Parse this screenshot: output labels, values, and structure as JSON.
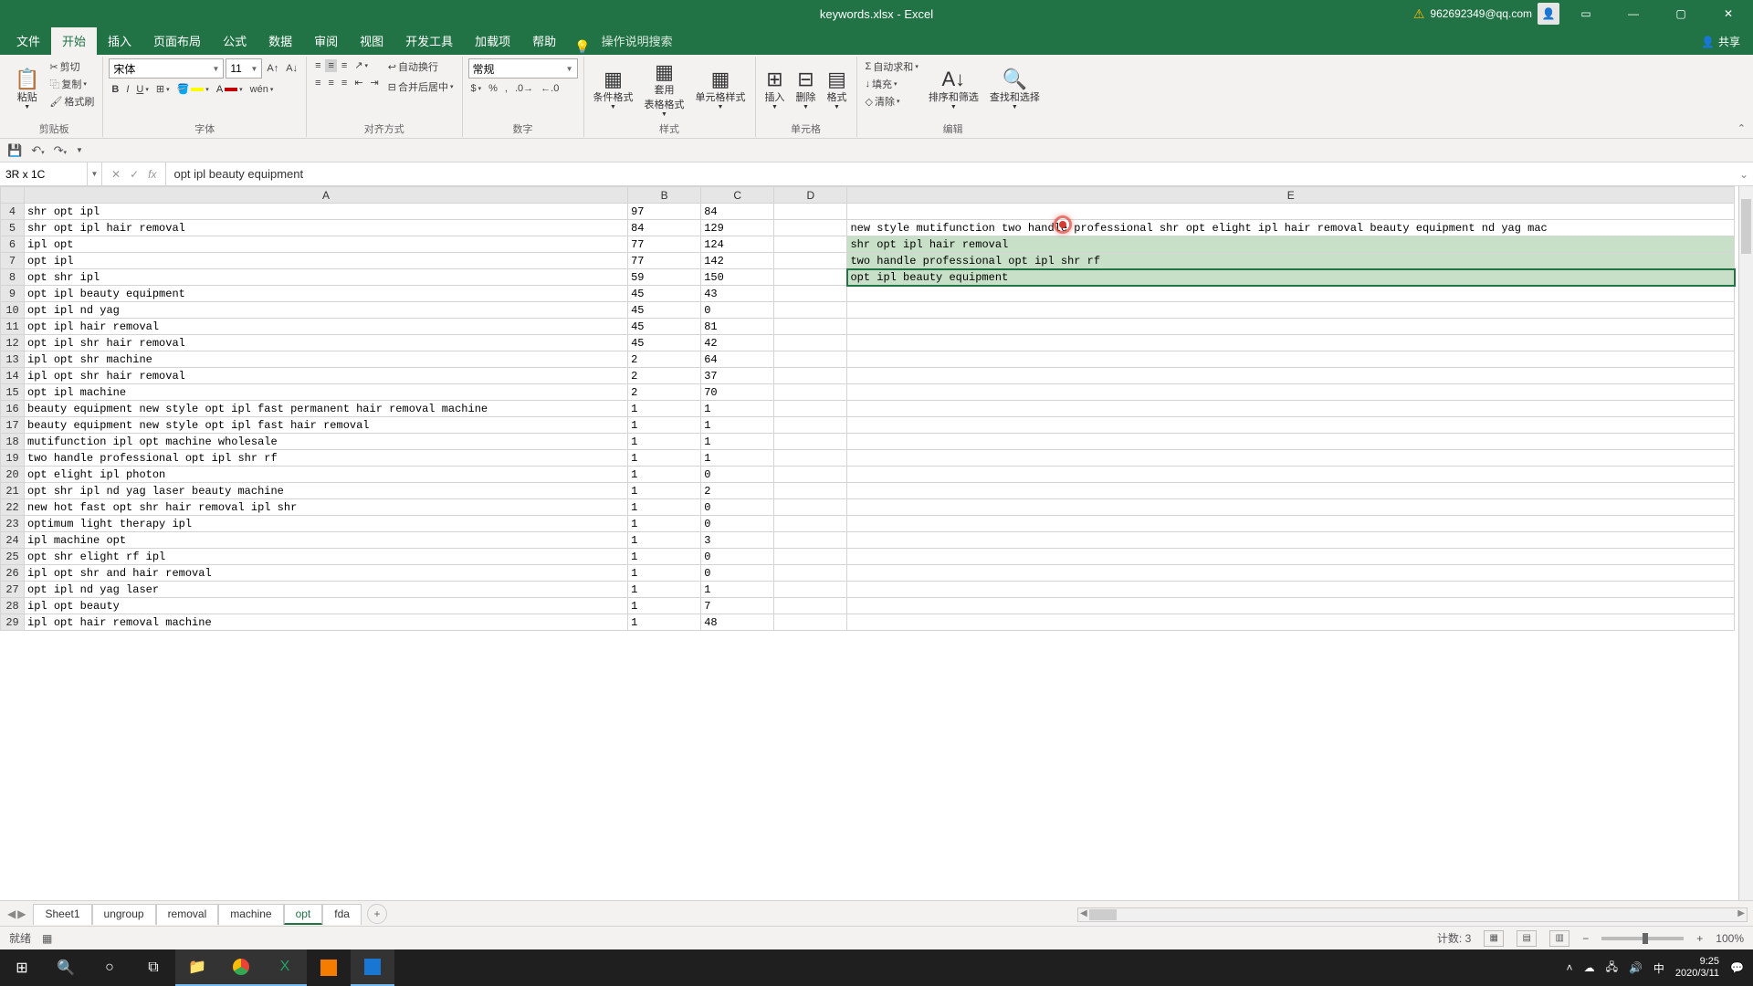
{
  "titlebar": {
    "title": "keywords.xlsx - Excel",
    "account": "962692349@qq.com"
  },
  "tabs": {
    "file": "文件",
    "home": "开始",
    "insert": "插入",
    "page": "页面布局",
    "formulas": "公式",
    "data": "数据",
    "review": "审阅",
    "view": "视图",
    "dev": "开发工具",
    "addins": "加载项",
    "help": "帮助",
    "tellme": "操作说明搜索",
    "share": "共享"
  },
  "ribbon": {
    "clipboard": {
      "paste": "粘贴",
      "cut": "剪切",
      "copy": "复制",
      "fmtpainter": "格式刷",
      "label": "剪贴板"
    },
    "font": {
      "name": "宋体",
      "size": "11",
      "label": "字体"
    },
    "align": {
      "wrap": "自动换行",
      "merge": "合并后居中",
      "label": "对齐方式"
    },
    "number": {
      "fmt": "常规",
      "label": "数字"
    },
    "styles": {
      "cond": "条件格式",
      "tbl": "套用\n表格格式",
      "cell": "单元格样式",
      "label": "样式"
    },
    "cells": {
      "ins": "插入",
      "del": "删除",
      "fmt": "格式",
      "label": "单元格"
    },
    "editing": {
      "sum": "自动求和",
      "fill": "填充",
      "clear": "清除",
      "sort": "排序和筛选",
      "find": "查找和选择",
      "label": "编辑"
    }
  },
  "namebox": "3R x 1C",
  "formula": "opt ipl beauty equipment",
  "columns": [
    "A",
    "B",
    "C",
    "D",
    "E"
  ],
  "rows": [
    {
      "n": 4,
      "a": "shr opt ipl",
      "b": "97",
      "c": "84",
      "e": ""
    },
    {
      "n": 5,
      "a": "shr opt ipl hair removal",
      "b": "84",
      "c": "129",
      "e": "new style mutifunction two handle professional shr opt elight ipl hair removal beauty equipment nd yag mac"
    },
    {
      "n": 6,
      "a": "ipl opt",
      "b": "77",
      "c": "124",
      "e": "shr opt ipl hair removal"
    },
    {
      "n": 7,
      "a": "opt ipl",
      "b": "77",
      "c": "142",
      "e": "two handle professional opt ipl shr rf"
    },
    {
      "n": 8,
      "a": "opt shr ipl",
      "b": "59",
      "c": "150",
      "e": "opt ipl beauty equipment"
    },
    {
      "n": 9,
      "a": "opt ipl beauty equipment",
      "b": "45",
      "c": "43",
      "e": ""
    },
    {
      "n": 10,
      "a": "opt ipl nd yag",
      "b": "45",
      "c": "0",
      "e": ""
    },
    {
      "n": 11,
      "a": "opt ipl hair removal",
      "b": "45",
      "c": "81",
      "e": ""
    },
    {
      "n": 12,
      "a": "opt ipl shr hair removal",
      "b": "45",
      "c": "42",
      "e": ""
    },
    {
      "n": 13,
      "a": "ipl opt shr machine",
      "b": "2",
      "c": "64",
      "e": ""
    },
    {
      "n": 14,
      "a": "ipl opt shr hair removal",
      "b": "2",
      "c": "37",
      "e": ""
    },
    {
      "n": 15,
      "a": "opt ipl machine",
      "b": "2",
      "c": "70",
      "e": ""
    },
    {
      "n": 16,
      "a": "beauty equipment new style opt ipl fast permanent hair removal machine",
      "b": "1",
      "c": "1",
      "e": ""
    },
    {
      "n": 17,
      "a": "beauty equipment new style opt ipl fast hair removal",
      "b": "1",
      "c": "1",
      "e": ""
    },
    {
      "n": 18,
      "a": "mutifunction ipl opt machine wholesale",
      "b": "1",
      "c": "1",
      "e": ""
    },
    {
      "n": 19,
      "a": "two handle professional opt ipl shr rf",
      "b": "1",
      "c": "1",
      "e": ""
    },
    {
      "n": 20,
      "a": "opt elight ipl photon",
      "b": "1",
      "c": "0",
      "e": ""
    },
    {
      "n": 21,
      "a": "opt shr ipl nd yag laser beauty machine",
      "b": "1",
      "c": "2",
      "e": ""
    },
    {
      "n": 22,
      "a": "new hot fast opt shr hair removal ipl shr",
      "b": "1",
      "c": "0",
      "e": ""
    },
    {
      "n": 23,
      "a": "optimum light  therapy ipl",
      "b": "1",
      "c": "0",
      "e": ""
    },
    {
      "n": 24,
      "a": "ipl machine opt",
      "b": "1",
      "c": "3",
      "e": ""
    },
    {
      "n": 25,
      "a": "opt shr elight rf ipl",
      "b": "1",
      "c": "0",
      "e": ""
    },
    {
      "n": 26,
      "a": "ipl opt shr and hair removal",
      "b": "1",
      "c": "0",
      "e": ""
    },
    {
      "n": 27,
      "a": "opt ipl nd yag laser",
      "b": "1",
      "c": "1",
      "e": ""
    },
    {
      "n": 28,
      "a": "ipl opt beauty",
      "b": "1",
      "c": "7",
      "e": ""
    },
    {
      "n": 29,
      "a": "ipl opt hair removal machine",
      "b": "1",
      "c": "48",
      "e": ""
    }
  ],
  "sheettabs": [
    "Sheet1",
    "ungroup",
    "removal",
    "machine",
    "opt",
    "fda"
  ],
  "active_sheet": "opt",
  "status": {
    "ready": "就绪",
    "count_label": "计数:",
    "count": "3",
    "zoom": "100%"
  },
  "taskbar": {
    "time": "9:25",
    "date": "2020/3/11",
    "ime": "中"
  }
}
